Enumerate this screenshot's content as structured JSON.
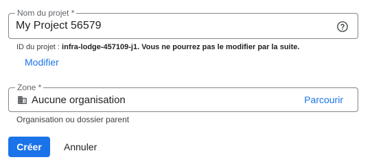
{
  "project_name": {
    "label": "Nom du projet *",
    "value": "My Project 56579",
    "help_icon": "help-circle-icon"
  },
  "project_id": {
    "prefix": "ID du projet : ",
    "value": "infra-lodge-457109-j1",
    "suffix": ". Vous ne pourrez pas le modifier par la suite."
  },
  "edit_link": "Modifier",
  "zone": {
    "label": "Zone *",
    "icon": "building-icon",
    "value": "Aucune organisation",
    "browse_label": "Parcourir",
    "hint": "Organisation ou dossier parent"
  },
  "actions": {
    "create_label": "Créer",
    "cancel_label": "Annuler"
  },
  "colors": {
    "accent": "#1a73e8",
    "border": "#80868b",
    "text": "#202124",
    "muted": "#5f6368"
  }
}
